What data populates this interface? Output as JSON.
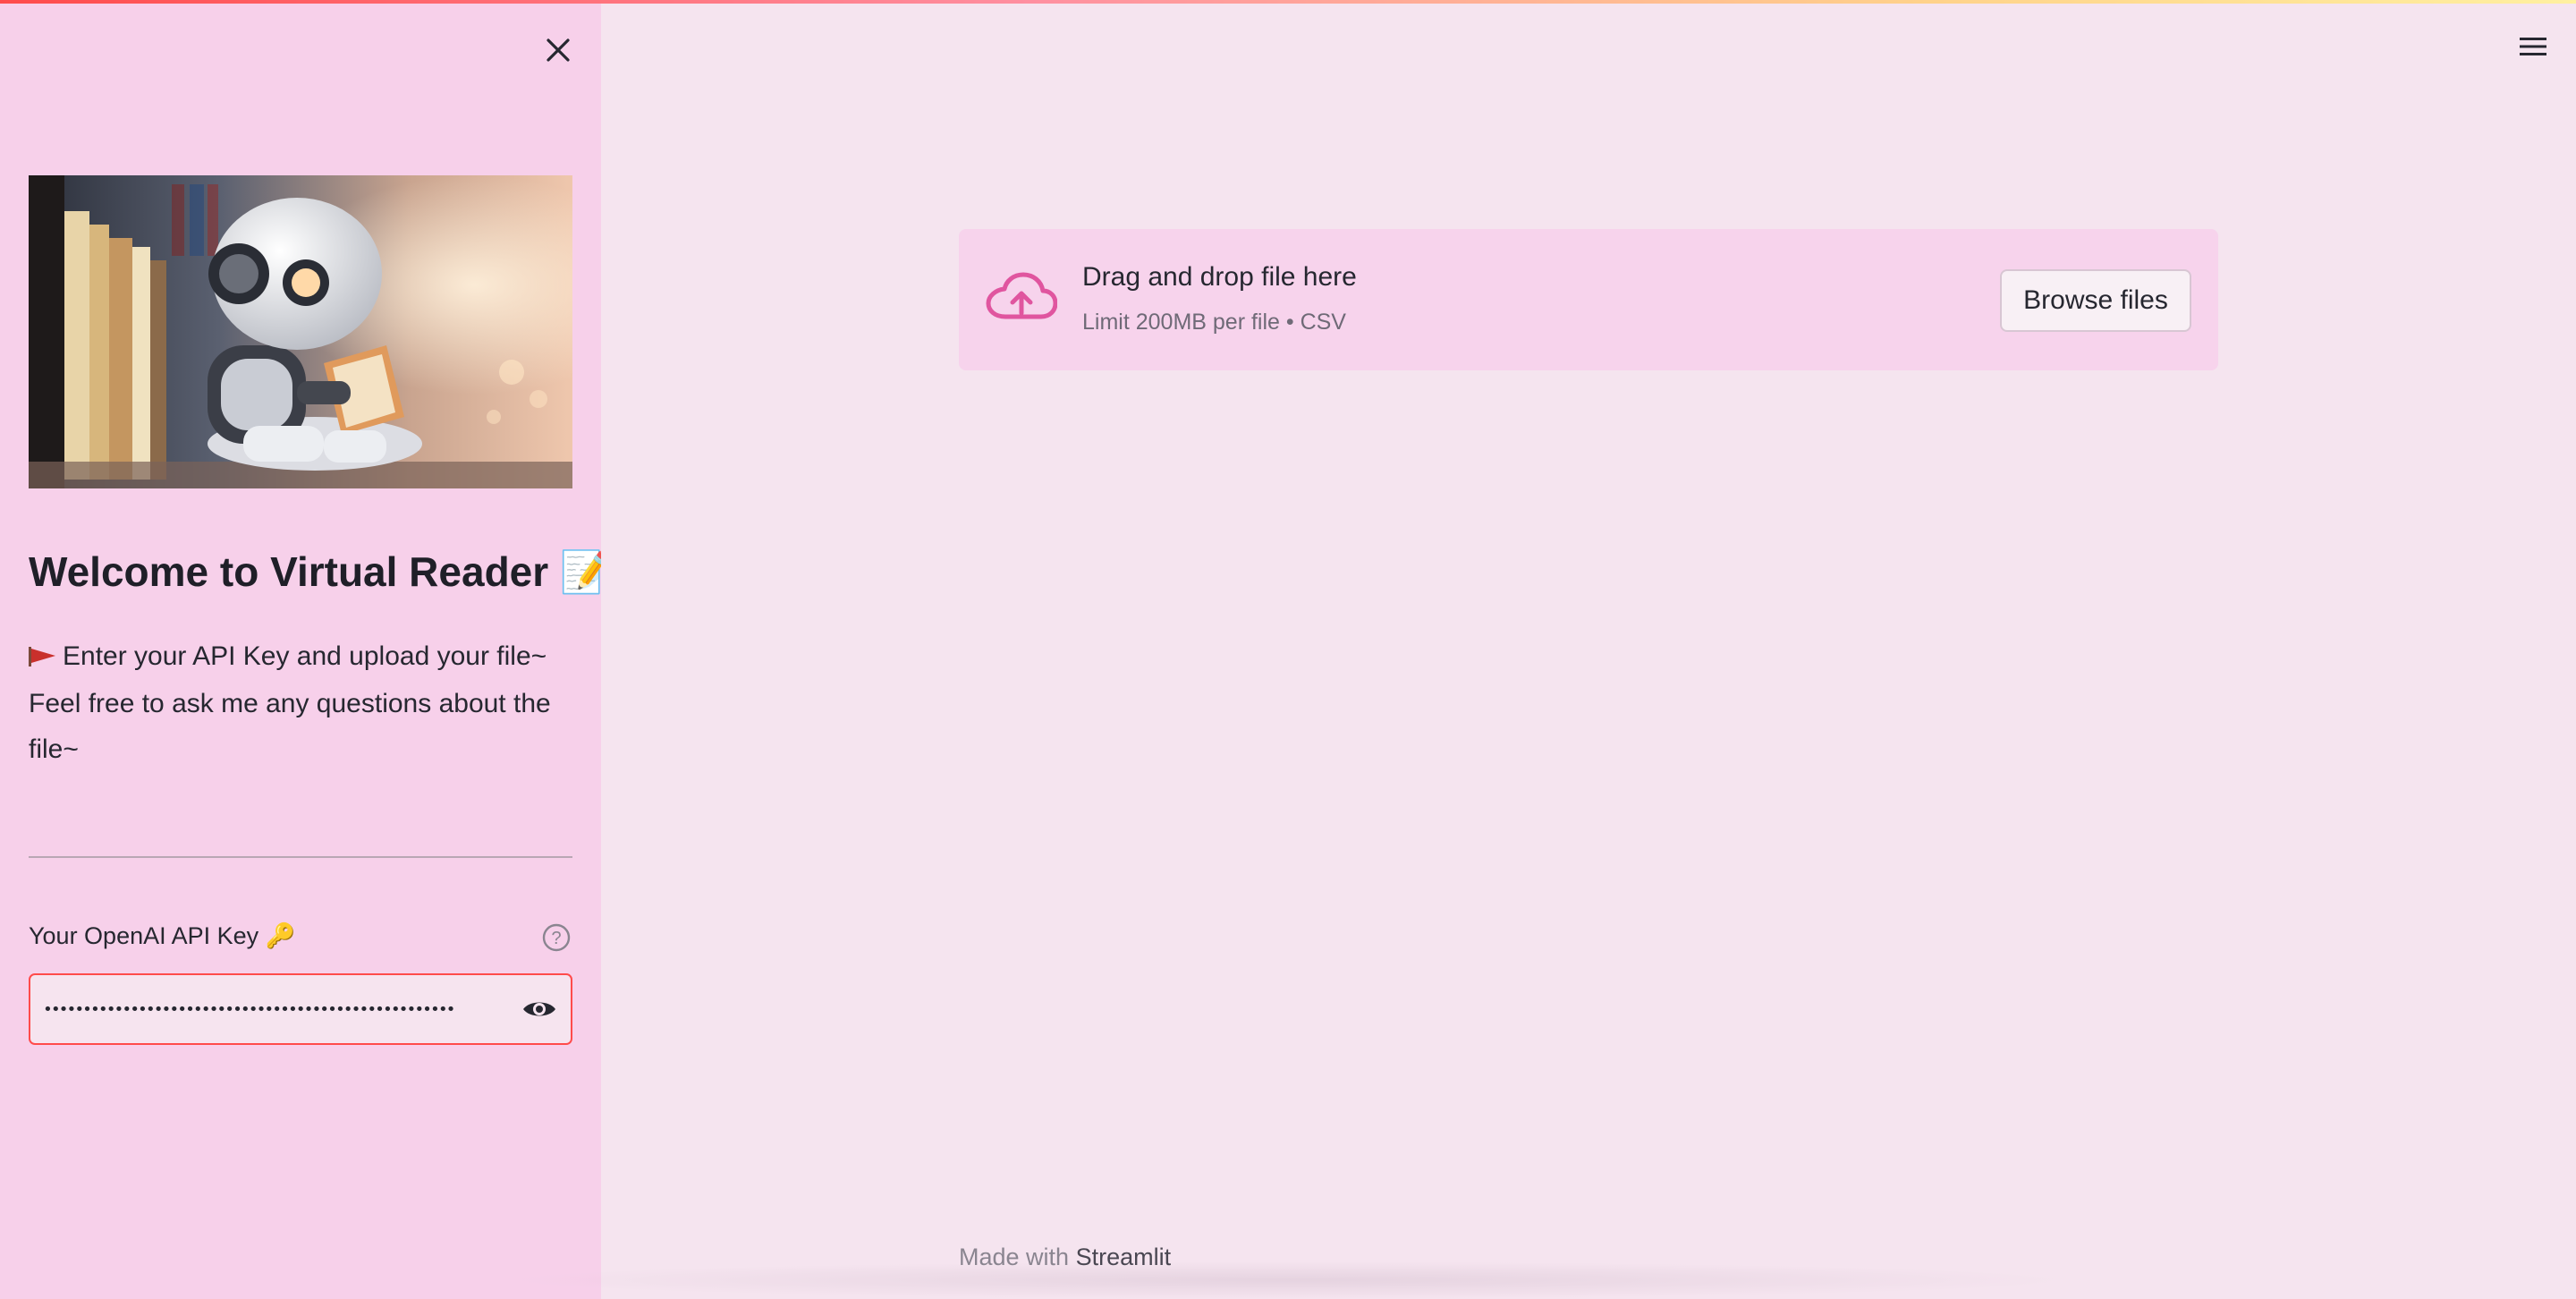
{
  "sidebar": {
    "title": "Welcome to Virtual Reader 📝",
    "intro_line1": "Enter your API Key and upload your file~",
    "intro_line2": "Feel free to ask me any questions about the file~",
    "api_key_label": "Your OpenAI API Key 🔑",
    "api_key_value": "••••••••••••••••••••••••••••••••••••••••••••••••••••",
    "hero_image": "robot-reading-book-illustration"
  },
  "uploader": {
    "title": "Drag and drop file here",
    "subtitle": "Limit 200MB per file • CSV",
    "browse_label": "Browse files"
  },
  "footer": {
    "made_with": "Made with",
    "brand": "Streamlit"
  },
  "icons": {
    "close": "close-icon",
    "menu": "hamburger-menu-icon",
    "help": "help-circle-icon",
    "eye": "eye-icon",
    "cloud": "cloud-upload-icon",
    "flag": "red-flag-icon"
  },
  "colors": {
    "sidebar_bg": "#f7d0ea",
    "main_bg": "#f5e4ef",
    "uploader_bg": "#f7d3ec",
    "accent": "#ff4b4b",
    "upload_icon": "#e0559f"
  }
}
